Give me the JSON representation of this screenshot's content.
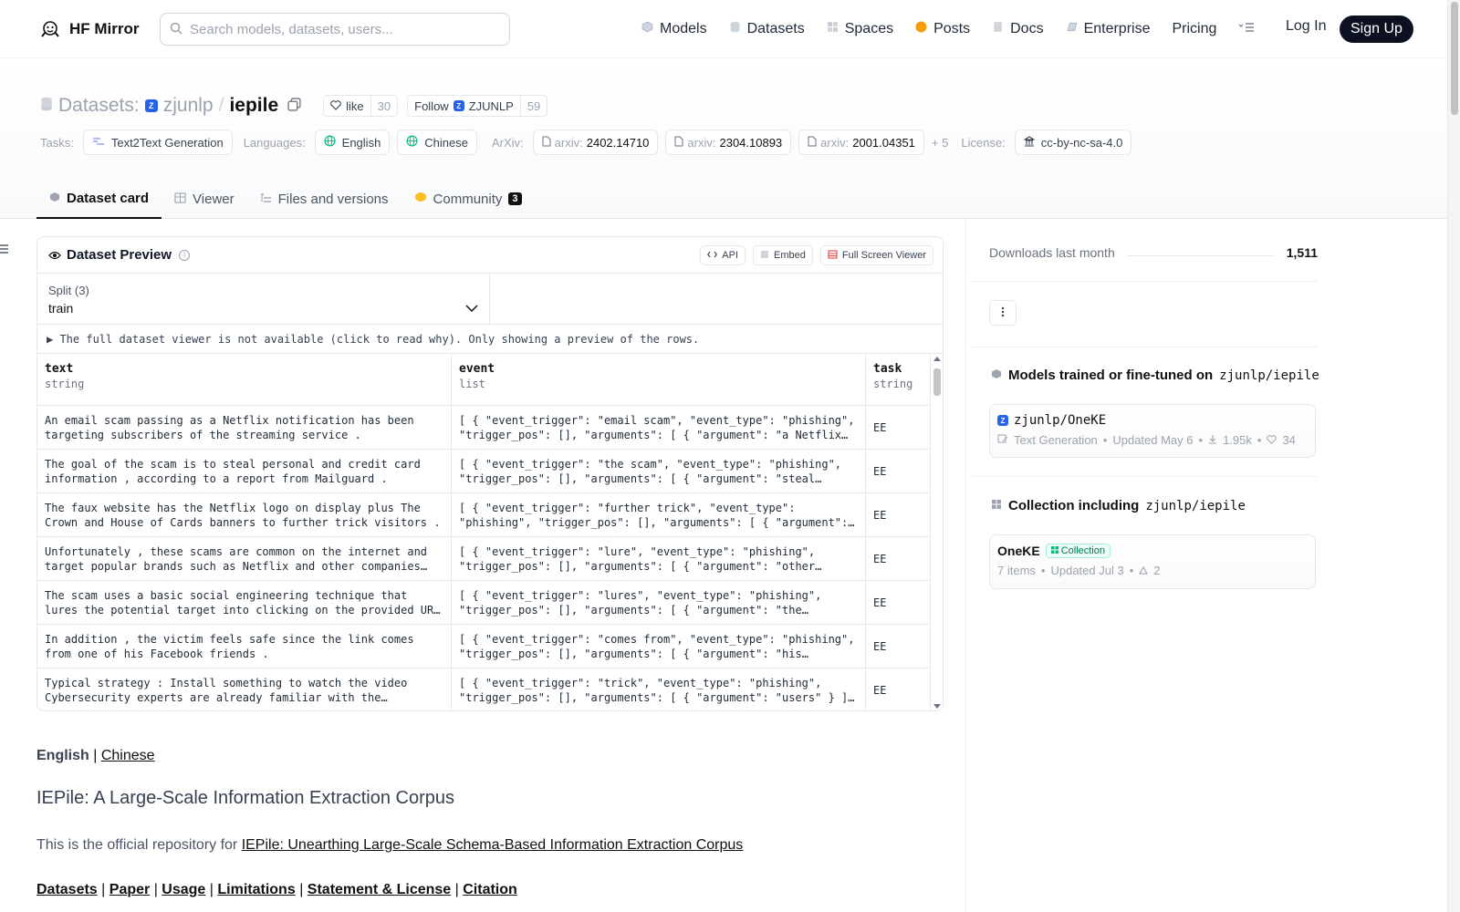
{
  "header": {
    "brand": "HF Mirror",
    "search_placeholder": "Search models, datasets, users...",
    "nav": [
      "Models",
      "Datasets",
      "Spaces",
      "Posts",
      "Docs",
      "Enterprise",
      "Pricing"
    ],
    "login": "Log In",
    "signup": "Sign Up"
  },
  "repo": {
    "type_label": "Datasets:",
    "org": "zjunlp",
    "name": "iepile",
    "like_label": "like",
    "like_count": "30",
    "follow_label": "Follow",
    "follow_org": "ZJUNLP",
    "follow_count": "59"
  },
  "tags": {
    "tasks_label": "Tasks:",
    "task": "Text2Text Generation",
    "languages_label": "Languages:",
    "languages": [
      "English",
      "Chinese"
    ],
    "arxiv_label": "ArXiv:",
    "arxiv_prefix": "arxiv:",
    "arxiv": [
      "2402.14710",
      "2304.10893",
      "2001.04351"
    ],
    "more": "+ 5",
    "license_label": "License:",
    "license": "cc-by-nc-sa-4.0"
  },
  "tabs": [
    "Dataset card",
    "Viewer",
    "Files and versions",
    "Community"
  ],
  "community_count": "3",
  "preview": {
    "title": "Dataset Preview",
    "buttons": [
      "API",
      "Embed",
      "Full Screen Viewer"
    ],
    "split_label": "Split (3)",
    "split_value": "train",
    "notice": "▶ The full dataset viewer is not available (click to read why). Only showing a preview of the rows.",
    "columns": [
      {
        "name": "text",
        "type": "string"
      },
      {
        "name": "event",
        "type": "list"
      },
      {
        "name": "task",
        "type": "string"
      }
    ],
    "rows": [
      {
        "text": "An email scam passing as a Netflix notification has been targeting subscribers of the streaming service .",
        "event": "[ { \"event_trigger\": \"email scam\", \"event_type\": \"phishing\", \"trigger_pos\": [], \"arguments\": [ { \"argument\": \"a Netflix notification\" } ] } ]",
        "task": "EE"
      },
      {
        "text": "The goal of the scam is to steal personal and credit card information , according to a report from Mailguard .",
        "event": "[ { \"event_trigger\": \"the scam\", \"event_type\": \"phishing\", \"trigger_pos\": [], \"arguments\": [ { \"argument\": \"steal personal and credit card information\" } ] } ]",
        "task": "EE"
      },
      {
        "text": "The faux website has the Netflix logo on display plus The Crown and House of Cards banners to further trick visitors .",
        "event": "[ { \"event_trigger\": \"further trick\", \"event_type\": \"phishing\", \"trigger_pos\": [], \"arguments\": [ { \"argument\": \"visitors\" } ] } ]",
        "task": "EE"
      },
      {
        "text": "Unfortunately , these scams are common on the internet and target popular brands such as Netflix and other companies with large user bases .",
        "event": "[ { \"event_trigger\": \"lure\", \"event_type\": \"phishing\", \"trigger_pos\": [], \"arguments\": [ { \"argument\": \"other companies\" } ] } ]",
        "task": "EE"
      },
      {
        "text": "The scam uses a basic social engineering technique that lures the potential target into clicking on the provided URL .",
        "event": "[ { \"event_trigger\": \"lures\", \"event_type\": \"phishing\", \"trigger_pos\": [], \"arguments\": [ { \"argument\": \"the potential target\" } ] } ]",
        "task": "EE"
      },
      {
        "text": "In addition , the victim feels safe since the link comes from one of his Facebook friends .",
        "event": "[ { \"event_trigger\": \"comes from\", \"event_type\": \"phishing\", \"trigger_pos\": [], \"arguments\": [ { \"argument\": \"his Facebook friends\" } ] } ]",
        "task": "EE"
      },
      {
        "text": "Typical strategy : Install something to watch the video Cybersecurity experts are already familiar with the technique",
        "event": "[ { \"event_trigger\": \"trick\", \"event_type\": \"phishing\", \"trigger_pos\": [], \"arguments\": [ { \"argument\": \"users\" } ] } ]",
        "task": "EE"
      }
    ]
  },
  "readme": {
    "lang_current": "English",
    "lang_sep": "|",
    "lang_other": "Chinese",
    "heading": "IEPile: A Large-Scale Information Extraction Corpus",
    "intro": "This is the official repository for ",
    "intro_link": "IEPile: Unearthing Large-Scale Schema-Based Information Extraction Corpus",
    "links": [
      "Datasets",
      "Paper",
      "Usage",
      "Limitations",
      "Statement & License",
      "Citation"
    ]
  },
  "sidebar": {
    "downloads_label": "Downloads last month",
    "downloads_value": "1,511",
    "models_title": "Models trained or fine-tuned on",
    "models_repo": "zjunlp/iepile",
    "model": {
      "name": "zjunlp/OneKE",
      "task": "Text Generation",
      "updated": "Updated May 6",
      "downloads": "1.95k",
      "likes": "34"
    },
    "collection_title": "Collection including",
    "collection_repo": "zjunlp/iepile",
    "collection": {
      "name": "OneKE",
      "badge": "Collection",
      "items": "7 items",
      "updated": "Updated Jul 3",
      "upvotes": "2"
    }
  },
  "colors": {
    "accent_dark": "#0b1120",
    "badge_blue": "#2563eb",
    "posts_orange": "#f59e0b",
    "community_yellow": "#fbbf24",
    "collection_green": "#047857"
  }
}
